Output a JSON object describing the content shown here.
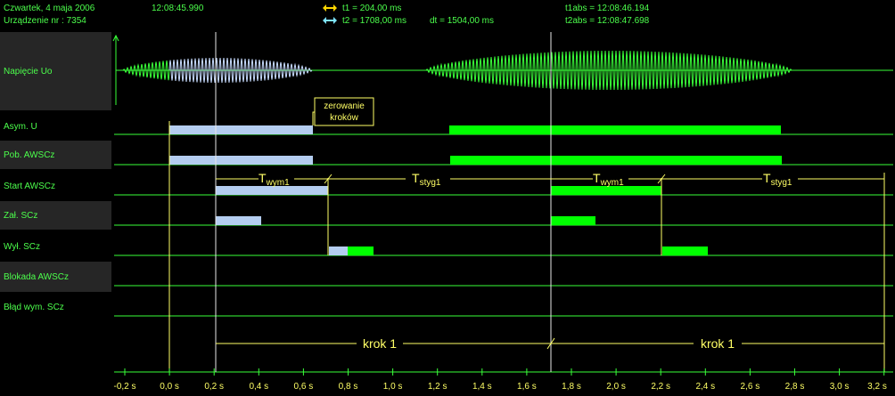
{
  "header": {
    "date": "Czwartek,  4  maja  2006",
    "time": "12:08:45.990",
    "device": "Urządzenie nr :  7354",
    "t1": "t1 = 204,00 ms",
    "t2": "t2 = 1708,00 ms",
    "dt": "dt = 1504,00 ms",
    "t1abs": "t1abs = 12:08:46.194",
    "t2abs": "t2abs = 12:08:47.698"
  },
  "channels": [
    {
      "label": "Napięcie Uo"
    },
    {
      "label": "Asym. U"
    },
    {
      "label": "Pob. AWSCz"
    },
    {
      "label": "Start AWSCz"
    },
    {
      "label": "Zał. SCz"
    },
    {
      "label": "Wył. SCz"
    },
    {
      "label": "Blokada AWSCz"
    },
    {
      "label": "Błąd wym. SCz"
    }
  ],
  "annotations": {
    "reset_box": [
      "zerowanie",
      "kroków"
    ],
    "twym": {
      "main": "T",
      "sub": "wym1"
    },
    "tstyg": {
      "main": "T",
      "sub": "styg1"
    },
    "krok": "krok 1"
  },
  "axis": {
    "ticks": [
      "-0,2 s",
      "0,0 s",
      "0,2 s",
      "0,4 s",
      "0,6 s",
      "0,8 s",
      "1,0 s",
      "1,2 s",
      "1,4 s",
      "1,6 s",
      "1,8 s",
      "2,0 s",
      "2,2 s",
      "2,4 s",
      "2,6 s",
      "2,8 s",
      "3,0 s",
      "3,2 s"
    ]
  },
  "colors": {
    "background": "#000000",
    "trace": "#39ff39",
    "bar_green": "#00ff00",
    "bar_blue": "#b4cdf0",
    "cursor_t1": "#ffd700",
    "cursor_t2": "#7fe5ff",
    "annotation": "#ffff66"
  },
  "icons": {
    "t1_marker": "double-arrow-yellow-icon",
    "t2_marker": "double-arrow-cyan-icon"
  }
}
